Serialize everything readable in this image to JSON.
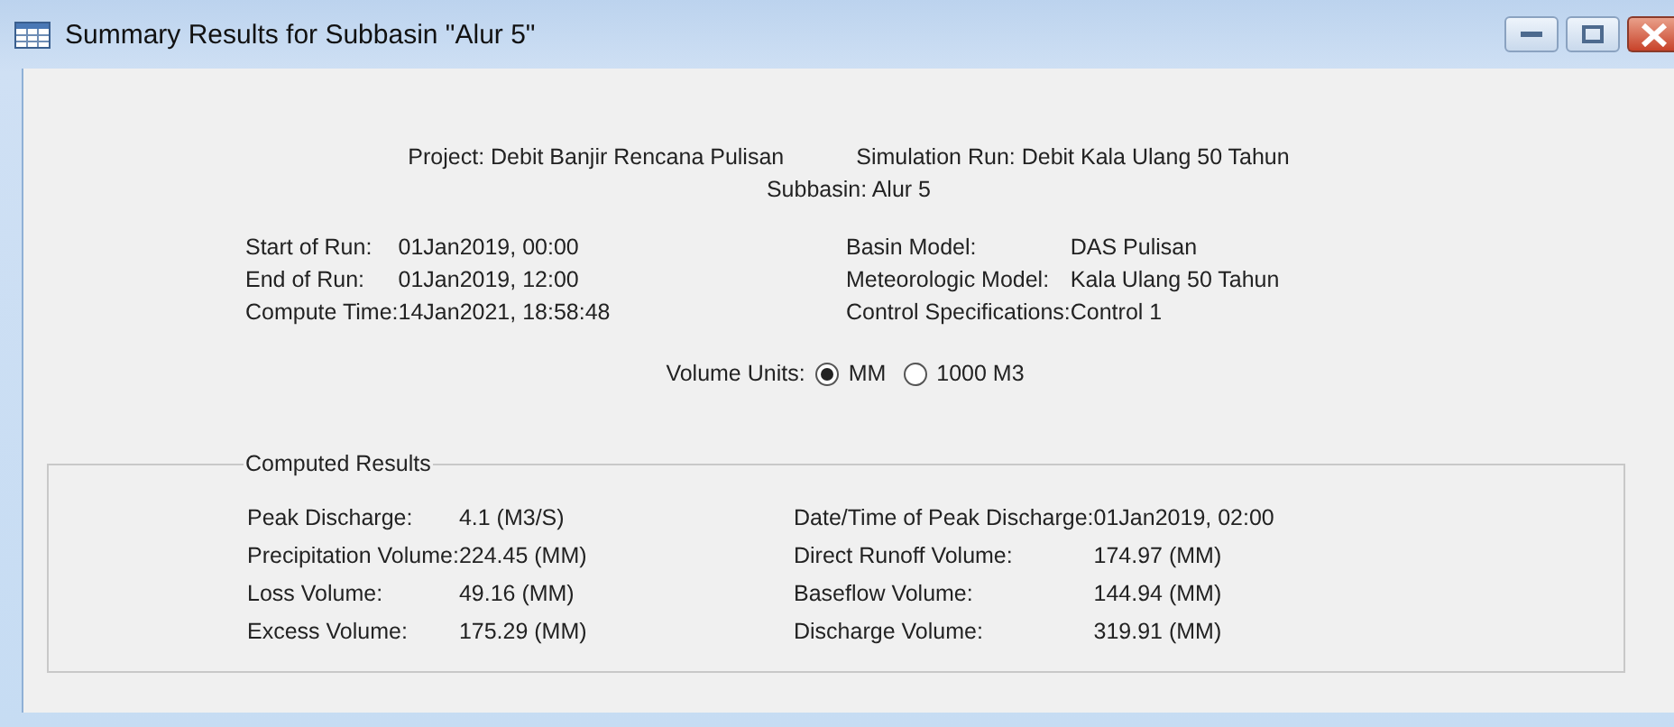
{
  "window": {
    "title": "Summary Results for Subbasin \"Alur 5\""
  },
  "header": {
    "project": "Project: Debit Banjir Rencana Pulisan",
    "simulation_run": "Simulation Run: Debit Kala Ulang 50 Tahun",
    "subbasin": "Subbasin: Alur 5"
  },
  "run_info": [
    {
      "label": "Start of Run:",
      "value": "01Jan2019, 00:00"
    },
    {
      "label": "End of Run:",
      "value": "01Jan2019, 12:00"
    },
    {
      "label": "Compute Time:",
      "value": "14Jan2021, 18:58:48"
    }
  ],
  "model_info": [
    {
      "label": "Basin Model:",
      "value": "DAS Pulisan"
    },
    {
      "label": "Meteorologic Model:",
      "value": "Kala Ulang 50 Tahun"
    },
    {
      "label": "Control Specifications:",
      "value": "Control 1"
    }
  ],
  "volume_units": {
    "label": "Volume Units:",
    "options": [
      {
        "label": "MM",
        "selected": true
      },
      {
        "label": "1000 M3",
        "selected": false
      }
    ]
  },
  "computed_results": {
    "title": "Computed Results",
    "left": [
      {
        "label": "Peak Discharge:",
        "value": "4.1 (M3/S)"
      },
      {
        "label": "Precipitation Volume:",
        "value": "224.45 (MM)"
      },
      {
        "label": "Loss Volume:",
        "value": "49.16 (MM)"
      },
      {
        "label": "Excess Volume:",
        "value": "175.29 (MM)"
      }
    ],
    "right": [
      {
        "label": "Date/Time of Peak Discharge:",
        "value": "01Jan2019, 02:00"
      },
      {
        "label": "Direct Runoff Volume:",
        "value": "174.97 (MM)"
      },
      {
        "label": "Baseflow Volume:",
        "value": "144.94 (MM)"
      },
      {
        "label": "Discharge Volume:",
        "value": "319.91 (MM)"
      }
    ]
  }
}
